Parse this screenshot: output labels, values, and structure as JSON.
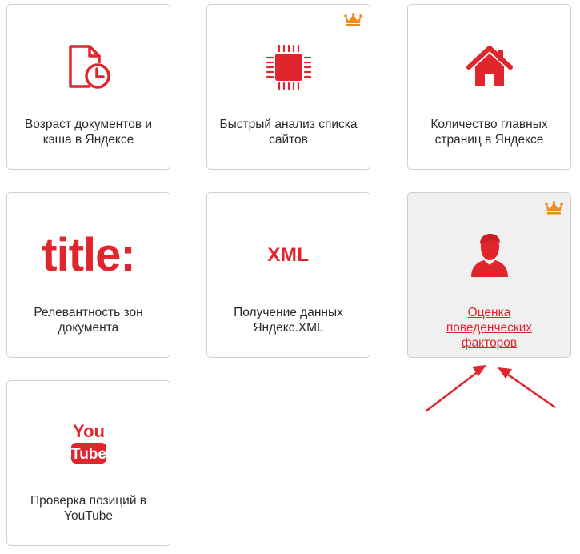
{
  "colors": {
    "accent": "#e0252c",
    "crown": "#f08a1c",
    "tile_border": "#d0d0d0",
    "active_tile_bg": "#f0f0f0"
  },
  "tiles": [
    {
      "label": "Возраст документов и кэша в Яндексе",
      "icon": "document-clock-icon",
      "premium": false,
      "active": false
    },
    {
      "label": "Быстрый анализ списка сайтов",
      "icon": "chip-icon",
      "premium": true,
      "active": false
    },
    {
      "label": "Количество главных страниц в Яндексе",
      "icon": "home-icon",
      "premium": false,
      "active": false
    },
    {
      "label": "Релевантность зон документа",
      "icon": "title-text-icon",
      "icon_text": "title:",
      "premium": false,
      "active": false
    },
    {
      "label": "Получение данных Яндекс.XML",
      "icon": "xml-text-icon",
      "icon_text": "XML",
      "premium": false,
      "active": false
    },
    {
      "label": "Оценка поведенческих факторов",
      "icon": "user-icon",
      "premium": true,
      "active": true
    },
    {
      "label": "Проверка позиций в YouTube",
      "icon": "youtube-icon",
      "icon_text_top": "You",
      "icon_text_bottom": "Tube",
      "premium": false,
      "active": false
    }
  ],
  "annotation": {
    "type": "red-arrows",
    "target": "Оценка поведенческих факторов",
    "count": 2
  }
}
